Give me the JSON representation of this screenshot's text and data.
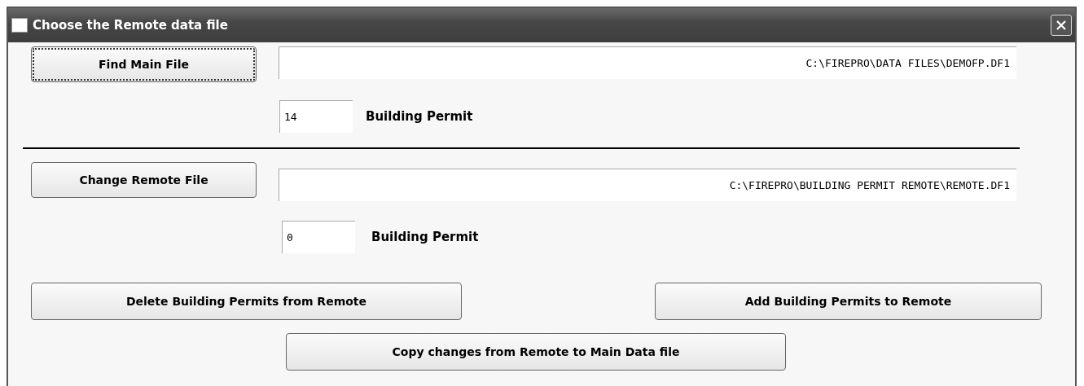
{
  "window": {
    "title": "Choose the Remote data file"
  },
  "main": {
    "button": {
      "label": "Find Main File",
      "focused": true
    },
    "path": "C:\\FIREPRO\\DATA FILES\\DEMOFP.DF1",
    "count": "14",
    "count_label": "Building Permit"
  },
  "remote": {
    "button": {
      "label": "Change Remote File",
      "focused": false
    },
    "path": "C:\\FIREPRO\\BUILDING PERMIT REMOTE\\REMOTE.DF1",
    "count": "0",
    "count_label": "Building Permit"
  },
  "actions": [
    {
      "label": "Delete Building Permits from Remote"
    },
    {
      "label": "Add Building Permits to Remote"
    },
    {
      "label": "Copy changes from Remote to Main Data file"
    }
  ]
}
